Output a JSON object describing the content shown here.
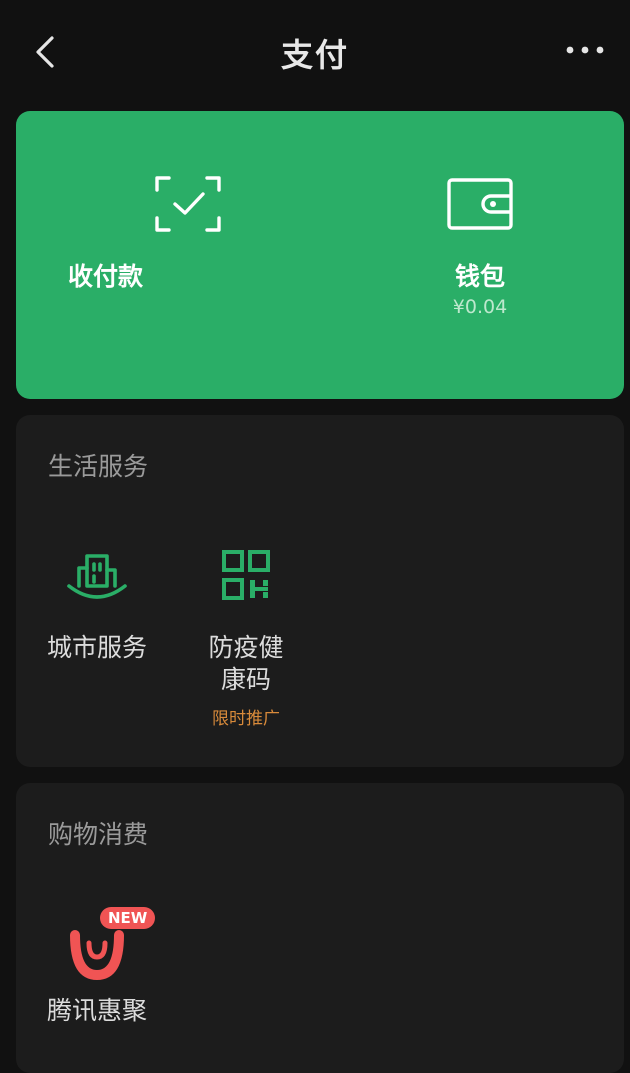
{
  "nav": {
    "title": "支付"
  },
  "hero": {
    "receive": {
      "label": "收付款"
    },
    "wallet": {
      "label": "钱包",
      "balance": "¥0.04"
    },
    "color": "#2aae67"
  },
  "life_services": {
    "title": "生活服务",
    "items": [
      {
        "label": "城市服务",
        "icon": "city-building-icon"
      },
      {
        "label": "防疫健\n康码",
        "icon": "qr-code-icon",
        "tag": "限时推广"
      }
    ]
  },
  "shopping": {
    "title": "购物消费",
    "items": [
      {
        "label": "腾讯惠聚",
        "icon": "tencent-huiju-icon",
        "badge": "NEW"
      }
    ]
  },
  "colors": {
    "accent_green": "#2aae67",
    "promo_orange": "#d88a3a",
    "badge_red": "#f05454"
  }
}
